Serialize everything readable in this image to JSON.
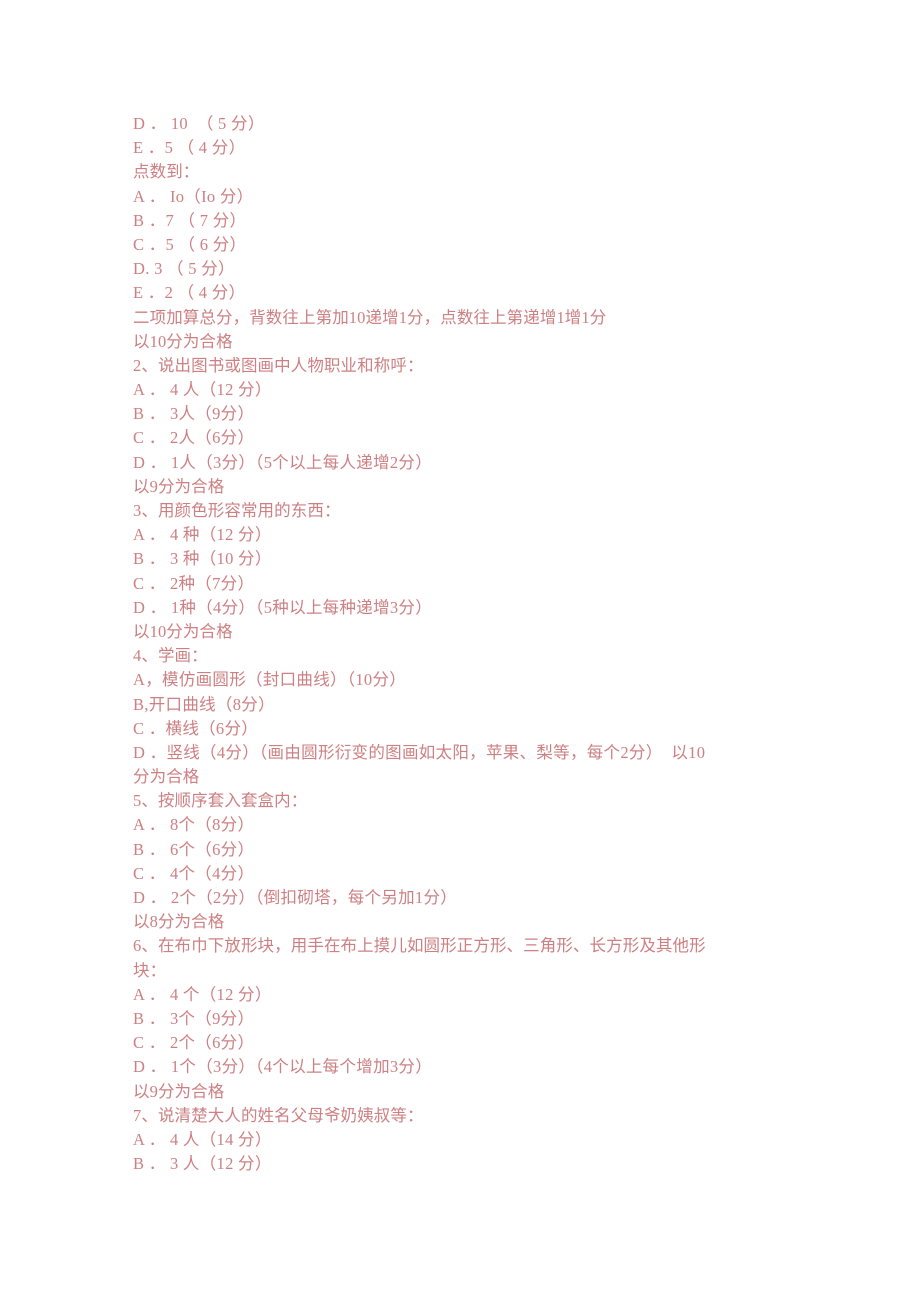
{
  "document": {
    "text_color": "#cd8083",
    "background_color": "#ffffff",
    "lines": [
      {
        "id": "l01",
        "text": "D ． 10  （ 5 分）",
        "style": "opt"
      },
      {
        "id": "l02",
        "text": "E ．5 （ 4 分）",
        "style": "opt"
      },
      {
        "id": "l03",
        "text": "点数到：",
        "style": "cjk"
      },
      {
        "id": "l04",
        "text": "A ． Io（Io 分）",
        "style": "opt"
      },
      {
        "id": "l05",
        "text": "B ．7 （ 7 分）",
        "style": "opt"
      },
      {
        "id": "l06",
        "text": "C ．5 （ 6 分）",
        "style": "opt"
      },
      {
        "id": "l07",
        "text": "D. 3 （ 5 分）",
        "style": "opt"
      },
      {
        "id": "l08",
        "text": "E ．2 （ 4 分）",
        "style": "opt"
      },
      {
        "id": "l09",
        "text": "二项加算总分，背数往上第加10递增1分，点数往上第递增1增1分",
        "style": "cjk"
      },
      {
        "id": "l10",
        "text": "以10分为合格",
        "style": "cjk"
      },
      {
        "id": "l11",
        "text": "2、说出图书或图画中人物职业和称呼：",
        "style": "cjk"
      },
      {
        "id": "l12",
        "text": "A ． 4 人（12 分）",
        "style": "opt"
      },
      {
        "id": "l13",
        "text": "B ． 3人（9分）",
        "style": "opt"
      },
      {
        "id": "l14",
        "text": "C ． 2人（6分）",
        "style": "opt"
      },
      {
        "id": "l15",
        "text": "D ． 1人（3分）（5个以上每人递增2分）",
        "style": "opt"
      },
      {
        "id": "l16",
        "text": "以9分为合格",
        "style": "cjk"
      },
      {
        "id": "l17",
        "text": "3、用颜色形容常用的东西：",
        "style": "cjk"
      },
      {
        "id": "l18",
        "text": "A ． 4 种（12 分）",
        "style": "opt"
      },
      {
        "id": "l19",
        "text": "B ． 3 种（10 分）",
        "style": "opt"
      },
      {
        "id": "l20",
        "text": "C ． 2种（7分）",
        "style": "opt"
      },
      {
        "id": "l21",
        "text": "D ． 1种（4分）（5种以上每种递增3分）",
        "style": "opt"
      },
      {
        "id": "l22",
        "text": "以10分为合格",
        "style": "cjk"
      },
      {
        "id": "l23",
        "text": "4、学画：",
        "style": "cjk"
      },
      {
        "id": "l24",
        "text": "A，模仿画圆形（封口曲线）（10分）",
        "style": "opt"
      },
      {
        "id": "l25",
        "text": "B,开口曲线（8分）",
        "style": "opt"
      },
      {
        "id": "l26",
        "text": "C ．横线（6分）",
        "style": "opt"
      },
      {
        "id": "l27",
        "text": "D ．竖线（4分）（画由圆形衍变的图画如太阳，苹果、梨等，每个2分）  以10",
        "style": "opt"
      },
      {
        "id": "l28",
        "text": "分为合格",
        "style": "cjk"
      },
      {
        "id": "l29",
        "text": "5、按顺序套入套盒内：",
        "style": "cjk"
      },
      {
        "id": "l30",
        "text": "A ． 8个（8分）",
        "style": "opt"
      },
      {
        "id": "l31",
        "text": "B ． 6个（6分）",
        "style": "opt"
      },
      {
        "id": "l32",
        "text": "C ． 4个（4分）",
        "style": "opt"
      },
      {
        "id": "l33",
        "text": "D ． 2个（2分）（倒扣砌塔，每个另加1分）",
        "style": "opt"
      },
      {
        "id": "l34",
        "text": "以8分为合格",
        "style": "cjk"
      },
      {
        "id": "l35",
        "text": "6、在布巾下放形块，用手在布上摸儿如圆形正方形、三角形、长方形及其他形",
        "style": "cjk"
      },
      {
        "id": "l36",
        "text": "块：",
        "style": "cjk"
      },
      {
        "id": "l37",
        "text": "A ． 4 个（12 分）",
        "style": "opt"
      },
      {
        "id": "l38",
        "text": "B ． 3个（9分）",
        "style": "opt"
      },
      {
        "id": "l39",
        "text": "C ． 2个（6分）",
        "style": "opt"
      },
      {
        "id": "l40",
        "text": "D ． 1个（3分）（4个以上每个增加3分）",
        "style": "opt"
      },
      {
        "id": "l41",
        "text": "以9分为合格",
        "style": "cjk"
      },
      {
        "id": "l42",
        "text": "7、说清楚大人的姓名父母爷奶姨叔等：",
        "style": "cjk"
      },
      {
        "id": "l43",
        "text": "A ． 4 人（14 分）",
        "style": "opt"
      },
      {
        "id": "l44",
        "text": "B ． 3 人（12 分）",
        "style": "opt"
      }
    ]
  }
}
